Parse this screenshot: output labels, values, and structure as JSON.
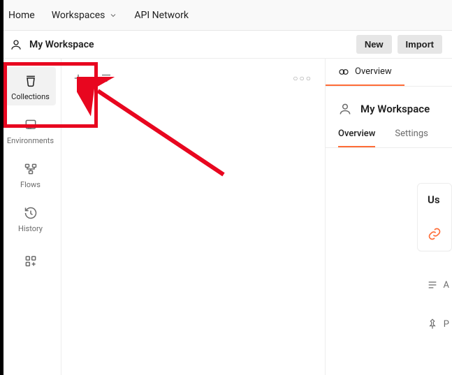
{
  "topnav": {
    "home": "Home",
    "workspaces": "Workspaces",
    "apinetwork": "API Network"
  },
  "workspace": {
    "title": "My Workspace",
    "new_label": "New",
    "import_label": "Import"
  },
  "rail": {
    "collections": "Collections",
    "environments": "Environments",
    "flows": "Flows",
    "history": "History"
  },
  "overview_tab": "Overview",
  "right": {
    "title": "My Workspace",
    "tabs": {
      "overview": "Overview",
      "settings": "Settings"
    },
    "card_title": "Us",
    "meta_a": "A",
    "meta_p": "P"
  }
}
